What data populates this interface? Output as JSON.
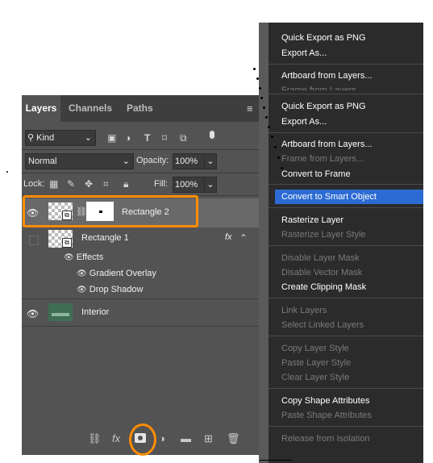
{
  "layers_panel": {
    "tabs": [
      "Layers",
      "Channels",
      "Paths"
    ],
    "filter": {
      "label": "Kind"
    },
    "blend_mode": "Normal",
    "opacity": {
      "label": "Opacity:",
      "value": "100%"
    },
    "lock": {
      "label": "Lock:"
    },
    "fill": {
      "label": "Fill:",
      "value": "100%"
    },
    "layers": [
      {
        "name": "Rectangle 2",
        "visible": true,
        "selected": true,
        "highlight_color": "#ff8c00"
      },
      {
        "name": "Rectangle 1",
        "visible": false,
        "fx_label": "fx"
      },
      {
        "name": "Effects"
      },
      {
        "name": "Gradient Overlay"
      },
      {
        "name": "Drop Shadow"
      },
      {
        "name": "Interior",
        "visible": true
      }
    ],
    "bottom_fx_label": "fx"
  },
  "context_menu": {
    "items": [
      {
        "label": "Quick Export as PNG",
        "enabled": true
      },
      {
        "label": "Export As...",
        "enabled": true
      },
      {
        "label": "Artboard from Layers...",
        "enabled": true
      },
      {
        "label": "Frame from Layers...",
        "enabled": false
      },
      {
        "label": "Quick Export as PNG",
        "enabled": true
      },
      {
        "label": "Export As...",
        "enabled": true
      },
      {
        "label": "Artboard from Layers...",
        "enabled": true
      },
      {
        "label": "Frame from Layers...",
        "enabled": false
      },
      {
        "label": "Convert to Frame",
        "enabled": true
      },
      {
        "label": "Convert to Smart Object",
        "enabled": true,
        "highlighted": true
      },
      {
        "label": "Rasterize Layer",
        "enabled": true
      },
      {
        "label": "Rasterize Layer Style",
        "enabled": false
      },
      {
        "label": "Disable Layer Mask",
        "enabled": false
      },
      {
        "label": "Disable Vector Mask",
        "enabled": false
      },
      {
        "label": "Create Clipping Mask",
        "enabled": true
      },
      {
        "label": "Link Layers",
        "enabled": false
      },
      {
        "label": "Select Linked Layers",
        "enabled": false
      },
      {
        "label": "Copy Layer Style",
        "enabled": false
      },
      {
        "label": "Paste Layer Style",
        "enabled": false
      },
      {
        "label": "Clear Layer Style",
        "enabled": false
      },
      {
        "label": "Copy Shape Attributes",
        "enabled": true
      },
      {
        "label": "Paste Shape Attributes",
        "enabled": false
      },
      {
        "label": "Release from Isolation",
        "enabled": false
      }
    ],
    "highlight_color": "#2c6bd3"
  },
  "annotation": {
    "color": "#ff8c00"
  }
}
